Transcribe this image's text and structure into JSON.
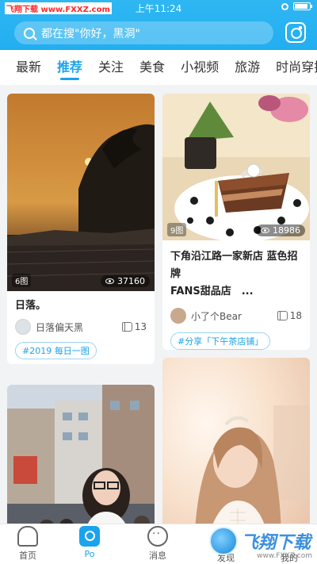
{
  "status_bar": {
    "left_text": "飞翔下载 www.FXXZ.com",
    "time": "上午11:24"
  },
  "search": {
    "placeholder": "都在搜\"你好，黑洞\""
  },
  "tabs": [
    {
      "label": "最新",
      "active": false
    },
    {
      "label": "推荐",
      "active": true
    },
    {
      "label": "关注",
      "active": false
    },
    {
      "label": "美食",
      "active": false
    },
    {
      "label": "小视频",
      "active": false
    },
    {
      "label": "旅游",
      "active": false
    },
    {
      "label": "时尚穿搭",
      "active": false
    }
  ],
  "cards": [
    {
      "photo_count": "6图",
      "views": "37160",
      "title": "日落。",
      "author": "日落偏天黑",
      "likes": "13",
      "tag": "#2019 每日一图"
    },
    {
      "photo_count": "9图",
      "views": "18986",
      "title_line1": "下角沿江路一家新店 蓝色招牌",
      "title_line2": "FANS甜品店　...",
      "author": "小了个Bear",
      "likes": "18",
      "tag": "#分享「下午茶店铺」"
    }
  ],
  "bottom_nav": [
    {
      "label": "首页",
      "icon": "home-icon",
      "active": false
    },
    {
      "label": "Po",
      "icon": "po-icon",
      "active": true
    },
    {
      "label": "消息",
      "icon": "message-icon",
      "active": false
    },
    {
      "label": "发现",
      "icon": "discover-icon",
      "active": false
    },
    {
      "label": "我的",
      "icon": "profile-icon",
      "active": false
    }
  ],
  "watermark": {
    "text": "飞翔下载",
    "url": "www.FXXZ.com"
  },
  "colors": {
    "accent": "#1aa3ee",
    "header": "#22aef0"
  }
}
